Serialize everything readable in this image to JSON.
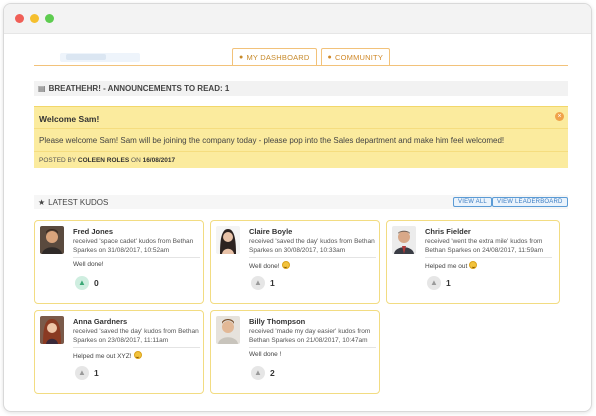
{
  "nav": {
    "tabs": [
      {
        "label": "MY DASHBOARD",
        "icon": "lightbulb-icon",
        "active": false
      },
      {
        "label": "COMMUNITY",
        "icon": "lightbulb-icon",
        "active": true
      }
    ]
  },
  "announcements": {
    "header": "BREATHEHR! - ANNOUNCEMENTS TO READ: 1",
    "item": {
      "title": "Welcome Sam!",
      "body": "Please welcome Sam! Sam will be joining the company today - please pop into the Sales department and make him feel welcomed!",
      "posted_by_prefix": "POSTED BY",
      "author": "COLEEN ROLES",
      "on_word": "ON",
      "date": "16/08/2017"
    }
  },
  "kudos": {
    "header": "LATEST KUDOS",
    "view_all_label": "VIEW ALL",
    "view_leaderboard_label": "VIEW LEADERBOARD",
    "cards": [
      {
        "name": "Fred Jones",
        "desc": "received 'space cadet' kudos from Bethan Sparkes on 31/08/2017, 10:52am",
        "message": "Well done!",
        "emoji": false,
        "likes": "0",
        "liked": true
      },
      {
        "name": "Claire Boyle",
        "desc": "received 'saved the day' kudos from Bethan Sparkes on 30/08/2017, 10:33am",
        "message": "Well done!",
        "emoji": true,
        "likes": "1",
        "liked": false
      },
      {
        "name": "Chris Fielder",
        "desc": "received 'went the extra mile' kudos from Bethan Sparkes on 24/08/2017, 11:59am",
        "message": "Helped me out",
        "emoji": true,
        "likes": "1",
        "liked": false
      },
      {
        "name": "Anna Gardners",
        "desc": "received 'saved the day' kudos from Bethan Sparkes on 23/08/2017, 11:11am",
        "message": "Helped me out XYZ!",
        "emoji": true,
        "likes": "1",
        "liked": false
      },
      {
        "name": "Billy Thompson",
        "desc": "received 'made my day easier' kudos from Bethan Sparkes on 21/08/2017, 10:47am",
        "message": "Well done !",
        "emoji": false,
        "likes": "2",
        "liked": false
      }
    ]
  },
  "colors": {
    "accent": "#f2c27a",
    "announcement_bg": "#fbeb9e",
    "link_blue": "#3a7cc2"
  }
}
